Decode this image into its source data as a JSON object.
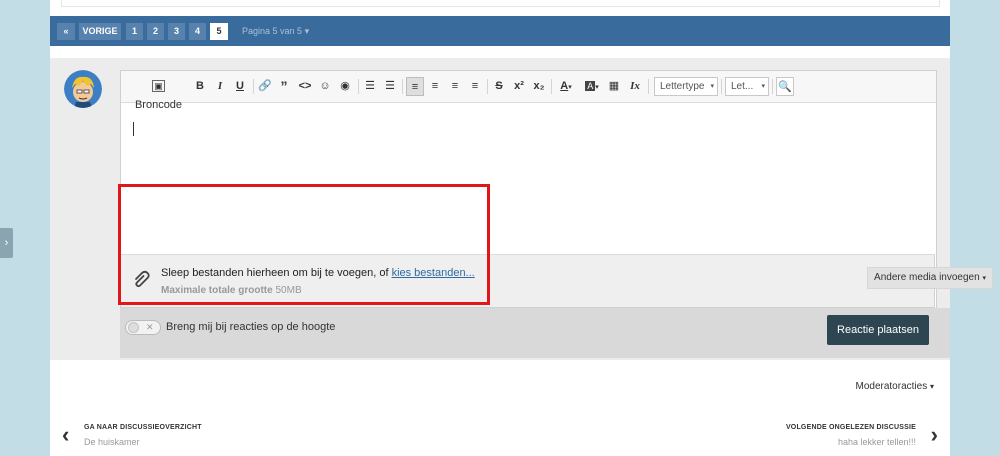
{
  "pagination": {
    "prev_label": "VORIGE",
    "pages": [
      "1",
      "2",
      "3",
      "4",
      "5"
    ],
    "current_page": "5",
    "info": "Pagina 5 van 5"
  },
  "toolbar": {
    "source_label": "Broncode",
    "bold": "B",
    "italic": "I",
    "underline": "U",
    "quote": "”",
    "code": "<>",
    "strike": "S",
    "superscript": "x²",
    "subscript": "x₂",
    "font_color": "A",
    "clear_format": "Ix",
    "font_family_placeholder": "Lettertype",
    "font_size_placeholder": "Let..."
  },
  "attachments": {
    "text": "Sleep bestanden hierheen om bij te voegen, of ",
    "link": "kies bestanden...",
    "max_label": "Maximale totale grootte",
    "max_value": "50MB",
    "media_button": "Andere media invoegen"
  },
  "follow": {
    "label": "Breng mij bij reacties op de hoogte",
    "enabled": false
  },
  "submit_label": "Reactie plaatsen",
  "moderator_actions": "Moderatoracties",
  "nav": {
    "prev_title": "GA NAAR DISCUSSIEOVERZICHT",
    "prev_sub": "De huiskamer",
    "next_title": "VOLGENDE ONGELEZEN DISCUSSIE",
    "next_sub": "haha lekker tellen!!!"
  },
  "colors": {
    "pagination_bar": "#3a6b9d",
    "submit_button": "#2e4652",
    "highlight": "#e0161b"
  }
}
